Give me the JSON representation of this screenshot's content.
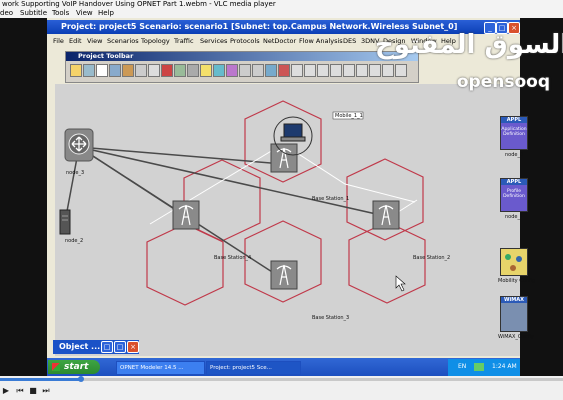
{
  "vlc": {
    "title": "work Supporting VoIP Handover Using OPNET Part 1.webm - VLC media player",
    "menu": [
      "deo",
      "Subtitle",
      "Tools",
      "View",
      "Help"
    ]
  },
  "opnet": {
    "title": "Project: project5 Scenario: scenario1  [Subnet: top.Campus Network.Wireless Subnet_0]",
    "menu": [
      "File",
      "Edit",
      "View",
      "Scenarios",
      "Topology",
      "Traffic",
      "Services",
      "Protocols",
      "NetDoctor",
      "Flow Analysis",
      "DES",
      "3DNV",
      "Design",
      "Window",
      "Help"
    ],
    "project_toolbar_title": "Project Toolbar",
    "nodes": {
      "router": "node_3",
      "server": "node_2",
      "base_stations": [
        "Base Station_1",
        "Base Station_2",
        "Base Station_3",
        "Base Station_4"
      ],
      "mobile": "Mobile_1_1"
    },
    "side_objects": [
      {
        "badge": "APPL",
        "label": "Application Definition",
        "node": "node_0"
      },
      {
        "badge": "APPL",
        "label": "Profile Definition",
        "node": "node_1"
      },
      {
        "badge": "",
        "label": "Mobility Config",
        "node": ""
      },
      {
        "badge": "WiMAX",
        "label": "WiMAX_Config",
        "node": ""
      }
    ],
    "object_panel": "Object ..."
  },
  "taskbar": {
    "start": "start",
    "buttons": [
      "OPNET Modeler 14.5 ...",
      "Project: project5 Sce..."
    ],
    "lang": "EN",
    "clock": "1:24 AM"
  },
  "watermark": {
    "arabic": "السوق المفتوح",
    "latin": "opensooq"
  },
  "colors": {
    "xp_blue": "#0b3fb5",
    "canvas": "#d2d2d2",
    "cell_red": "#c0394a",
    "start_green": "#2c8a30"
  }
}
